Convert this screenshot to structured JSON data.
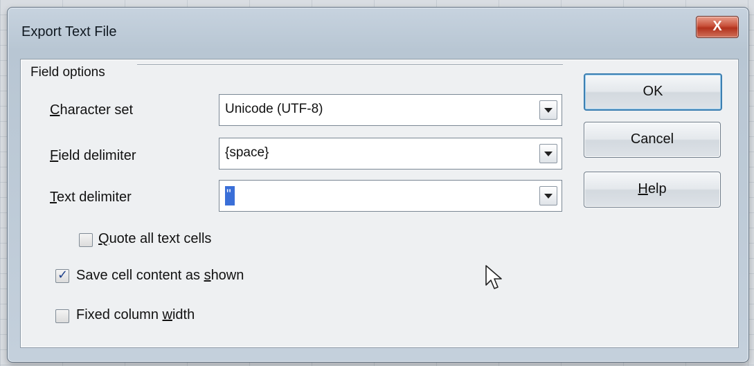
{
  "window": {
    "title": "Export Text File",
    "close_glyph": "X"
  },
  "group": {
    "title": "Field options"
  },
  "fields": {
    "character_set": {
      "label_u": "C",
      "label_rest": "haracter set",
      "value": "Unicode (UTF-8)"
    },
    "field_delimiter": {
      "label_u": "F",
      "label_rest": "ield delimiter",
      "value": "{space}"
    },
    "text_delimiter": {
      "label_u": "T",
      "label_rest": "ext delimiter",
      "value": "\""
    }
  },
  "checkboxes": {
    "quote_all": {
      "label_u": "Q",
      "label_rest": "uote all text cells",
      "checked": false
    },
    "save_as_shown": {
      "label_pre": "Save cell content as ",
      "label_u": "s",
      "label_rest": "hown",
      "checked": true
    },
    "fixed_width": {
      "label_pre": "Fixed column ",
      "label_u": "w",
      "label_rest": "idth",
      "checked": false
    }
  },
  "buttons": {
    "ok": "OK",
    "cancel": "Cancel",
    "help_u": "H",
    "help_rest": "elp"
  },
  "icons": {
    "dropdown": "chevron-down-icon",
    "cursor": "mouse-pointer-icon",
    "close": "close-icon"
  }
}
